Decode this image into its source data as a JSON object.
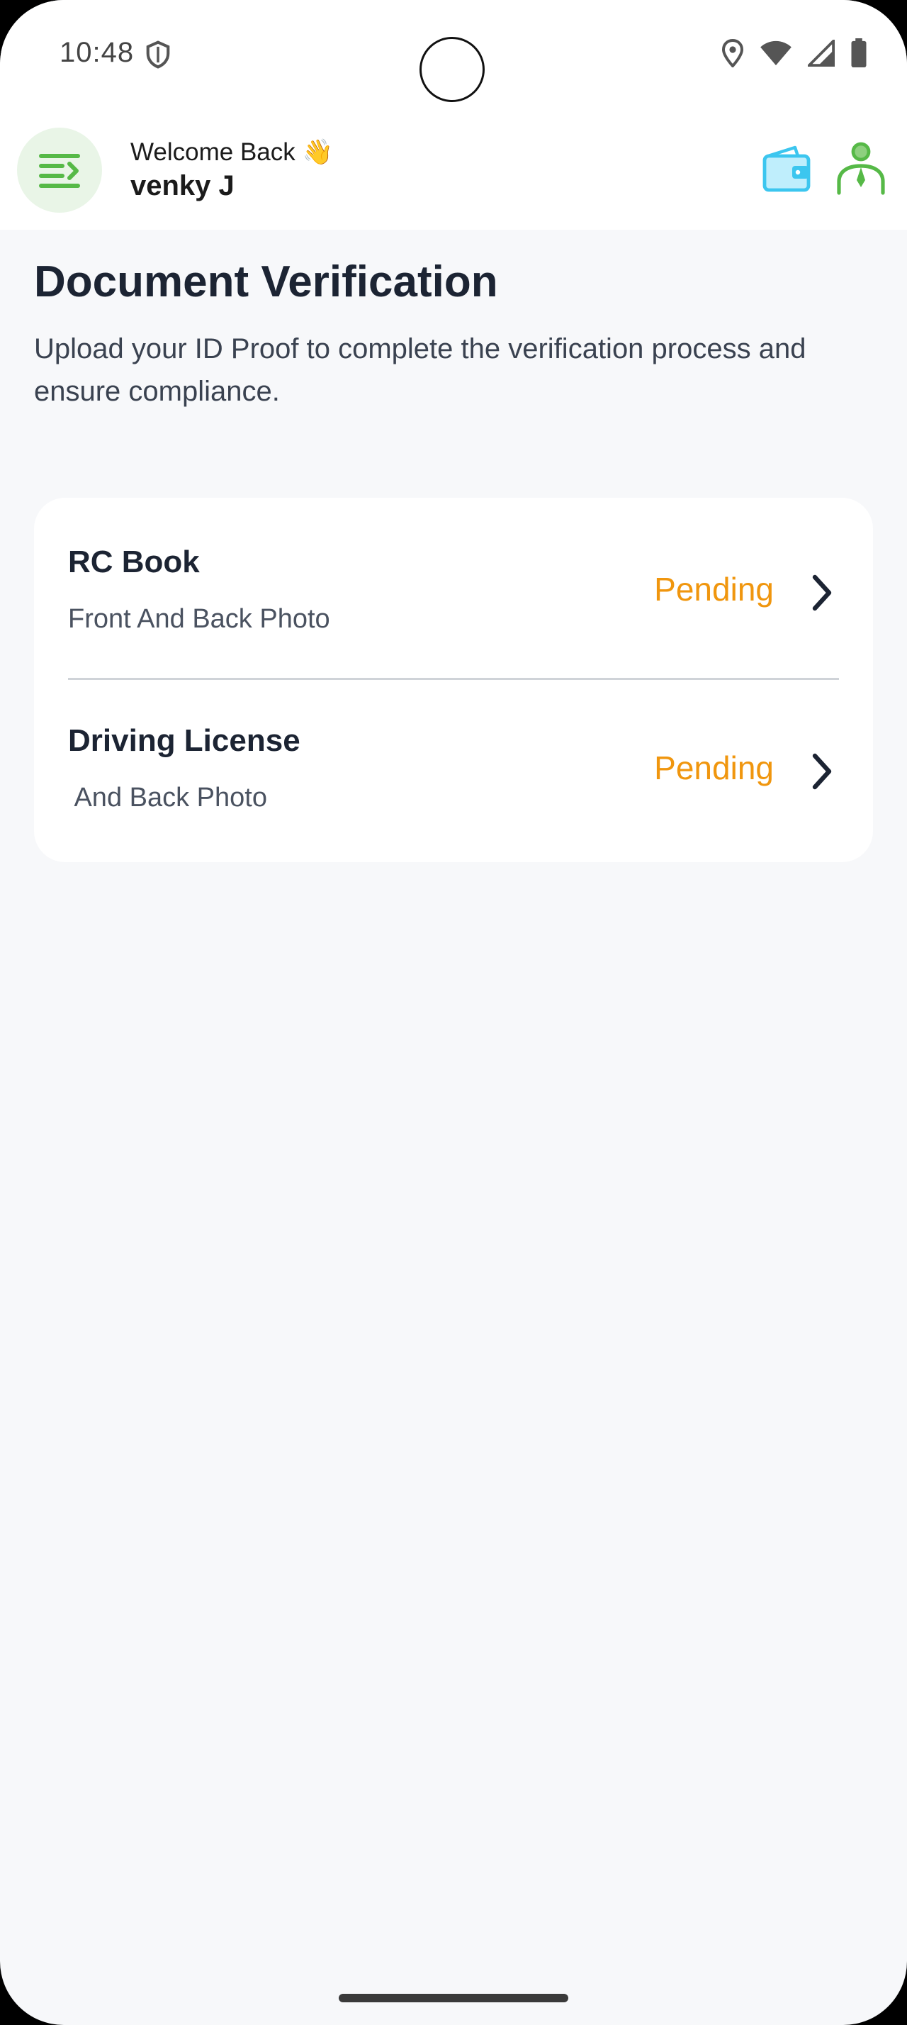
{
  "status_bar": {
    "time": "10:48"
  },
  "header": {
    "welcome": "Welcome Back 👋",
    "username": "venky J"
  },
  "page": {
    "title": "Document Verification",
    "description": "Upload your ID Proof to complete the verification process and ensure compliance."
  },
  "documents": [
    {
      "title": "RC Book",
      "subtitle": "Front And Back Photo",
      "status": "Pending"
    },
    {
      "title": "Driving License",
      "subtitle": " And Back Photo",
      "status": "Pending"
    }
  ],
  "colors": {
    "accent_green": "#56b947",
    "status_pending": "#f0960e",
    "wallet_blue": "#3cc6ef"
  }
}
